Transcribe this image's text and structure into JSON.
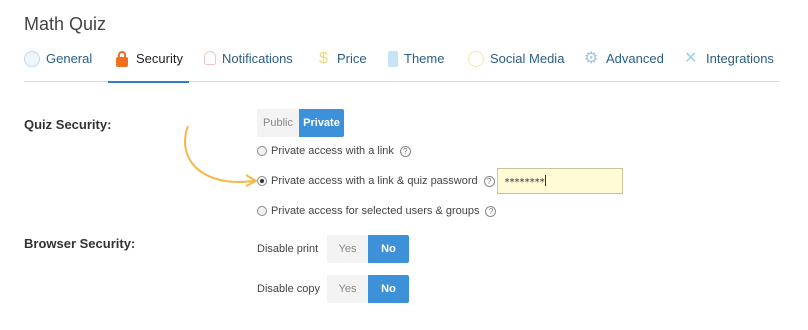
{
  "page": {
    "title": "Math Quiz"
  },
  "tabs": [
    {
      "label": "General",
      "icon": "circle-icon"
    },
    {
      "label": "Security",
      "icon": "lock-icon",
      "active": true
    },
    {
      "label": "Notifications",
      "icon": "bell-icon"
    },
    {
      "label": "Price",
      "icon": "dollar-icon"
    },
    {
      "label": "Theme",
      "icon": "theme-icon"
    },
    {
      "label": "Social Media",
      "icon": "social-icon"
    },
    {
      "label": "Advanced",
      "icon": "gear-icon"
    },
    {
      "label": "Integrations",
      "icon": "wrench-icon"
    }
  ],
  "quiz_security": {
    "label": "Quiz Security:",
    "visibility": {
      "options": [
        "Public",
        "Private"
      ],
      "selected": "Private"
    },
    "access_options": [
      {
        "label": "Private access with a link",
        "checked": false
      },
      {
        "label": "Private access with a link & quiz password",
        "checked": true
      },
      {
        "label": "Private access for selected users & groups",
        "checked": false
      }
    ],
    "password_value": "********",
    "help_glyph": "?"
  },
  "browser_security": {
    "label": "Browser Security:",
    "disable_print": {
      "label": "Disable print",
      "yes": "Yes",
      "no": "No",
      "selected": "No"
    },
    "disable_copy": {
      "label": "Disable copy",
      "yes": "Yes",
      "no": "No",
      "selected": "No"
    }
  },
  "colors": {
    "accent": "#3d91d9",
    "tab_text": "#2b5e86",
    "lock": "#f26f21",
    "annotation_arrow": "#f5b94a",
    "password_bg": "#fffbd7"
  }
}
